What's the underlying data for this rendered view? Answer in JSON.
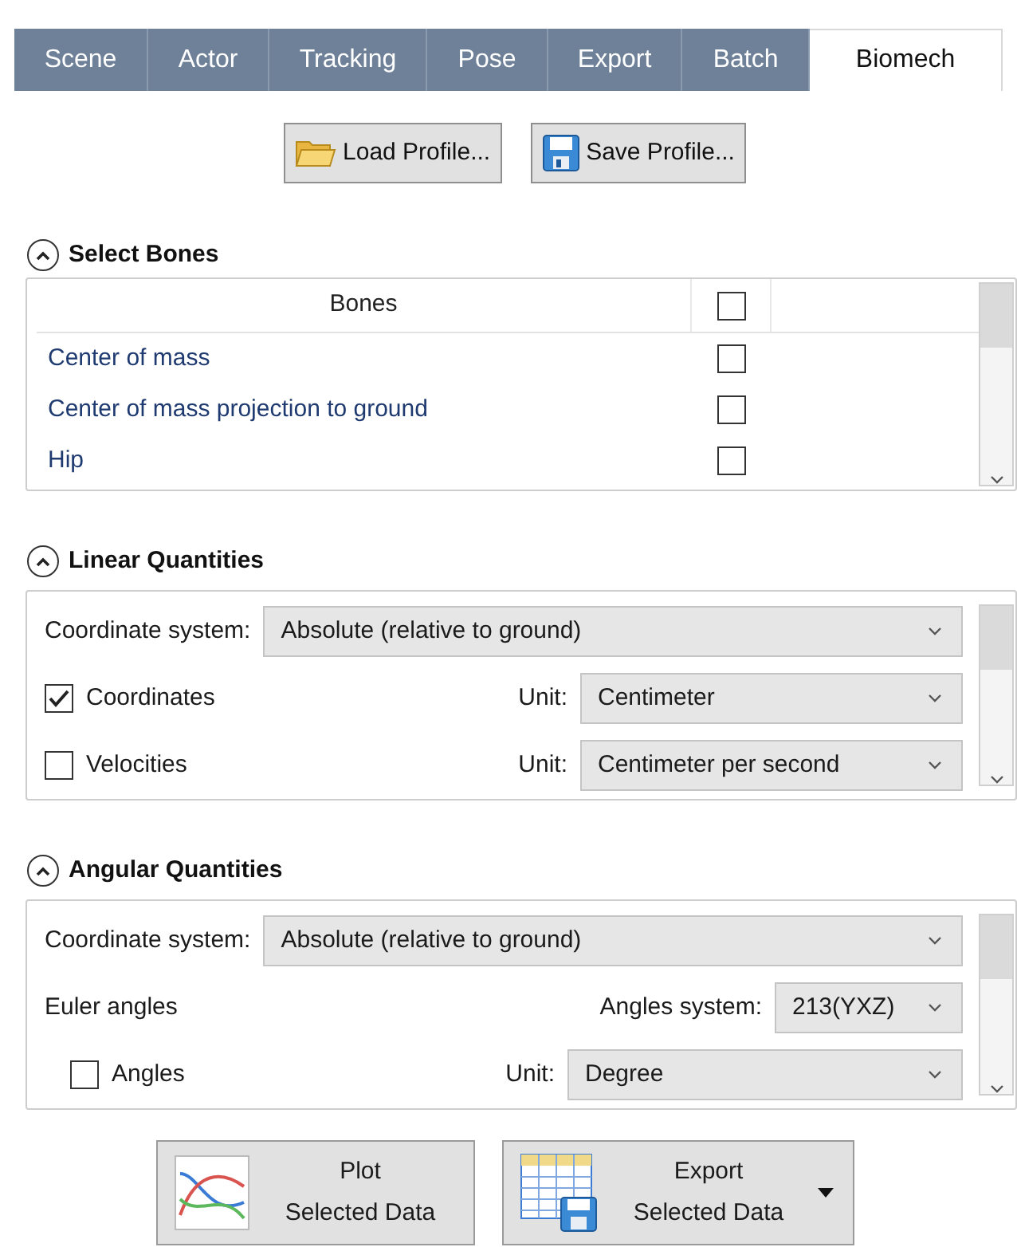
{
  "tabs": [
    {
      "label": "Scene",
      "selected": false
    },
    {
      "label": "Actor",
      "selected": false
    },
    {
      "label": "Tracking",
      "selected": false
    },
    {
      "label": "Pose",
      "selected": false
    },
    {
      "label": "Export",
      "selected": false
    },
    {
      "label": "Batch",
      "selected": false
    },
    {
      "label": "Biomech",
      "selected": true
    }
  ],
  "profile_buttons": [
    {
      "kind": "load",
      "label": "Load Profile..."
    },
    {
      "kind": "save",
      "label": "Save Profile..."
    }
  ],
  "sections": [
    {
      "kind": "table",
      "title": "Select Bones",
      "expanded": true,
      "column": "Bones",
      "header_checked": false,
      "rows": [
        {
          "name": "Center of mass",
          "checked": false
        },
        {
          "name": "Center of mass projection to ground",
          "checked": false
        },
        {
          "name": "Hip",
          "checked": false
        }
      ]
    },
    {
      "kind": "form",
      "title": "Linear Quantities",
      "expanded": true,
      "rows": [
        {
          "kind": "select",
          "label": "Coordinate system:",
          "value": "Absolute (relative to ground)"
        },
        {
          "kind": "check_unit",
          "label": "Coordinates",
          "checked": true,
          "unit_label": "Unit:",
          "value": "Centimeter"
        },
        {
          "kind": "check_unit",
          "label": "Velocities",
          "checked": false,
          "unit_label": "Unit:",
          "value": "Centimeter per second"
        }
      ]
    },
    {
      "kind": "form",
      "title": "Angular Quantities",
      "expanded": true,
      "rows": [
        {
          "kind": "select",
          "label": "Coordinate system:",
          "value": "Absolute (relative to ground)"
        },
        {
          "kind": "label_select",
          "label": "Euler angles",
          "select_label": "Angles system:",
          "value": "213(YXZ)"
        },
        {
          "kind": "check_unit_indent",
          "label": "Angles",
          "checked": false,
          "unit_label": "Unit:",
          "value": "Degree"
        }
      ]
    }
  ],
  "action_buttons": [
    {
      "kind": "plot",
      "lines": [
        "Plot",
        "Selected Data"
      ],
      "menu": false
    },
    {
      "kind": "export",
      "lines": [
        "Export",
        "Selected Data"
      ],
      "menu": true
    }
  ]
}
